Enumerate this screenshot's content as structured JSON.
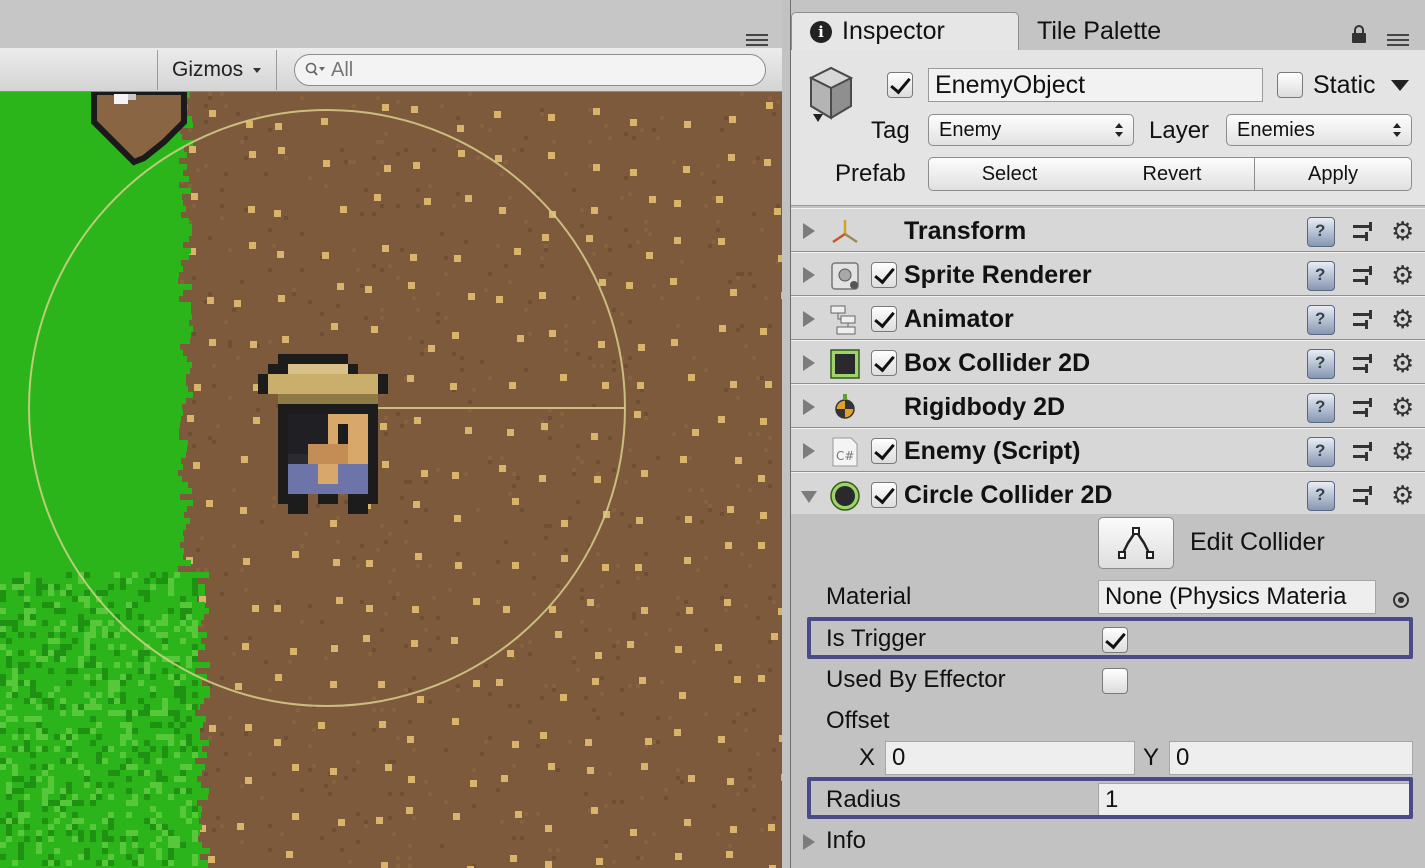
{
  "scene": {
    "toolbar": {
      "gizmos_label": "Gizmos",
      "search_value": "All"
    }
  },
  "inspector": {
    "tabs": [
      {
        "label": "Inspector",
        "icon": "info-icon",
        "active": true
      },
      {
        "label": "Tile Palette",
        "active": false
      }
    ],
    "object": {
      "active": true,
      "name": "EnemyObject",
      "static_label": "Static",
      "static_checked": false,
      "tag_label": "Tag",
      "tag_value": "Enemy",
      "layer_label": "Layer",
      "layer_value": "Enemies",
      "prefab_label": "Prefab",
      "prefab_buttons": [
        "Select",
        "Revert",
        "Apply"
      ]
    },
    "components": [
      {
        "name": "Transform",
        "icon": "transform-icon",
        "has_checkbox": false
      },
      {
        "name": "Sprite Renderer",
        "icon": "sprite-renderer-icon",
        "has_checkbox": true,
        "enabled": true
      },
      {
        "name": "Animator",
        "icon": "animator-icon",
        "has_checkbox": true,
        "enabled": true
      },
      {
        "name": "Box Collider 2D",
        "icon": "box-collider-icon",
        "has_checkbox": true,
        "enabled": true
      },
      {
        "name": "Rigidbody 2D",
        "icon": "rigidbody-icon",
        "has_checkbox": false
      },
      {
        "name": "Enemy (Script)",
        "icon": "csharp-script-icon",
        "has_checkbox": true,
        "enabled": true,
        "icon_text": "C#"
      },
      {
        "name": "Circle Collider 2D",
        "icon": "circle-collider-icon",
        "has_checkbox": true,
        "enabled": true,
        "expanded": true
      }
    ],
    "circle_collider": {
      "edit_collider_label": "Edit Collider",
      "material_label": "Material",
      "material_value": "None (Physics Materia",
      "is_trigger_label": "Is Trigger",
      "is_trigger": true,
      "used_by_effector_label": "Used By Effector",
      "used_by_effector": false,
      "offset_label": "Offset",
      "offset_x_label": "X",
      "offset_x": "0",
      "offset_y_label": "Y",
      "offset_y": "0",
      "radius_label": "Radius",
      "radius": "1",
      "info_label": "Info"
    }
  },
  "colors": {
    "grass": "#2bb51a",
    "dirt": "#7d5a3c",
    "dirt_speck": "#d9b46a",
    "gizmo_circle": "#d6d08a",
    "highlight": "#4a4a86"
  }
}
